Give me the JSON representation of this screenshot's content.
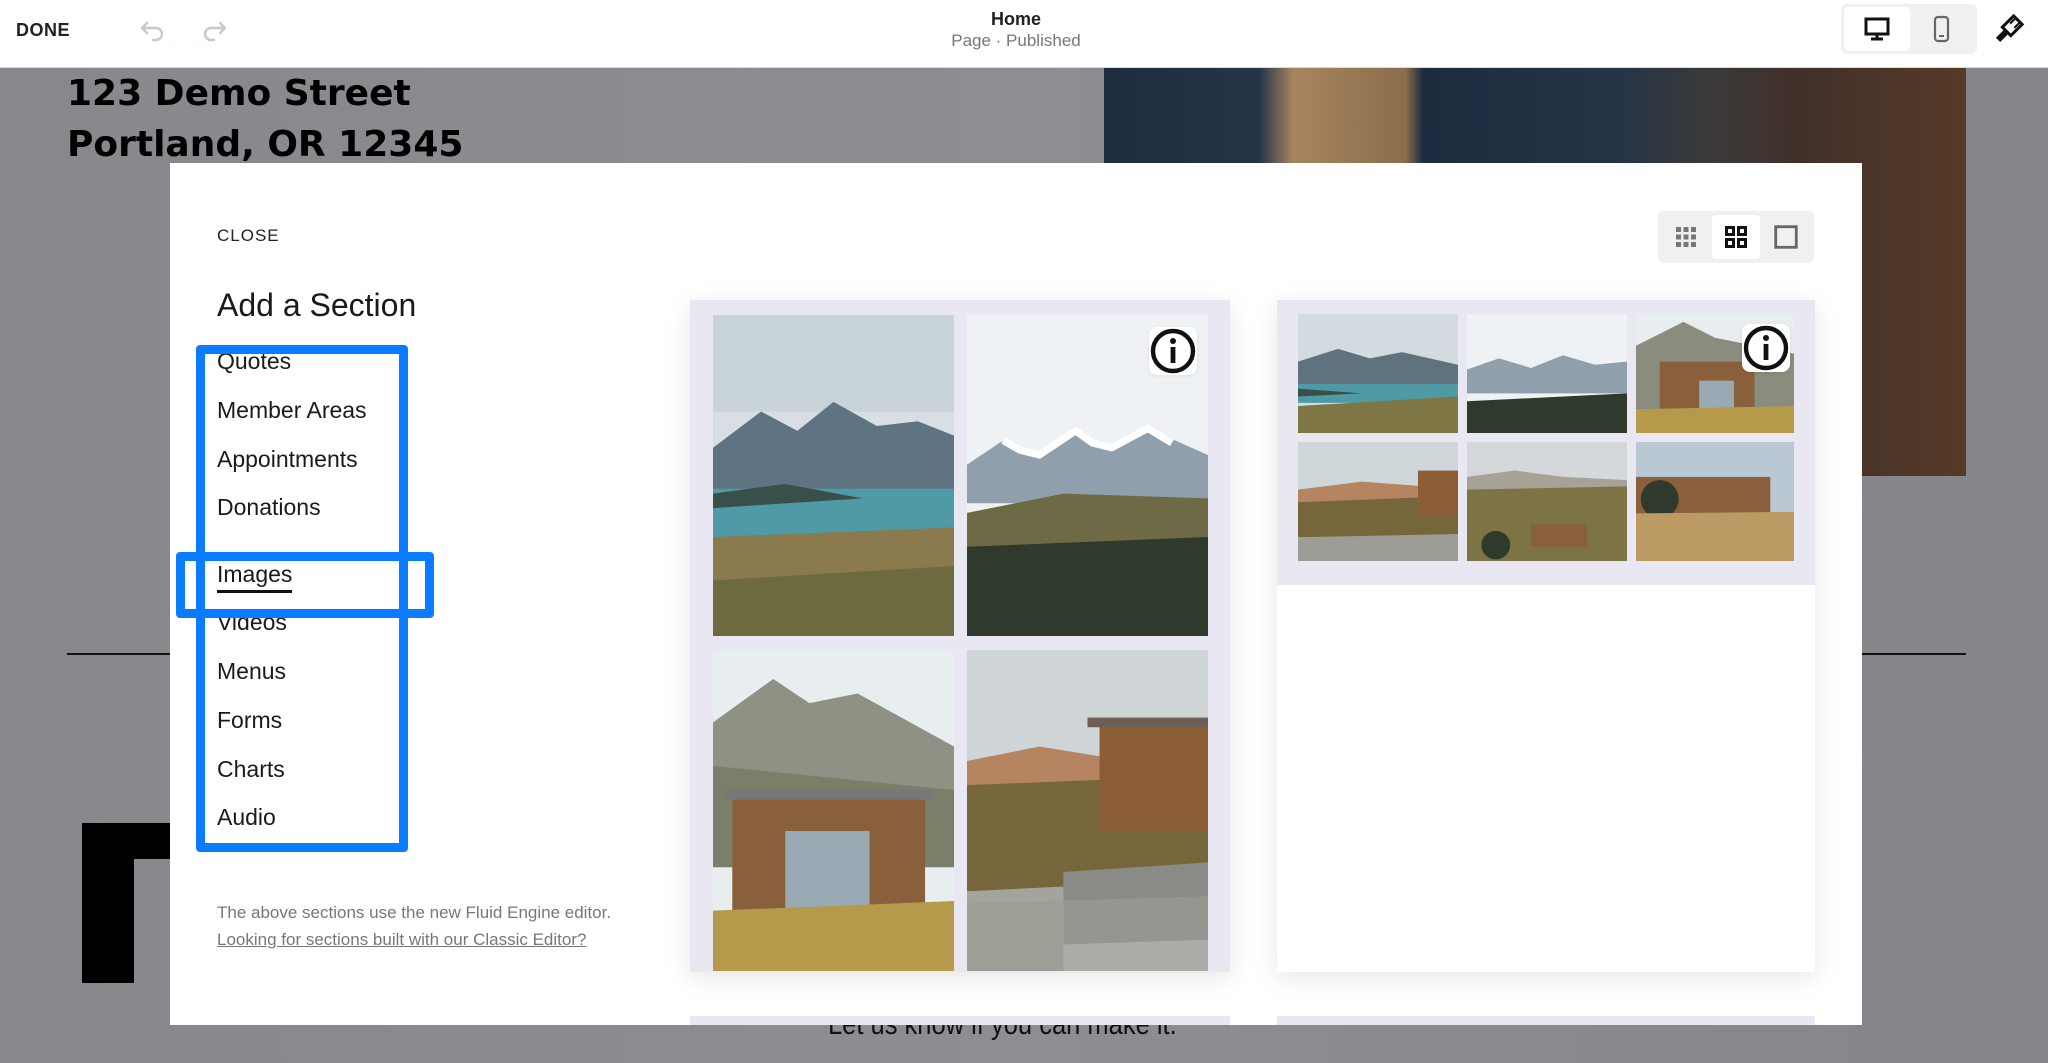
{
  "topbar": {
    "done_label": "DONE",
    "undo_icon": "undo-icon",
    "redo_icon": "redo-icon",
    "page_title": "Home",
    "page_subtitle": "Page · Published",
    "device_toggle": [
      {
        "icon": "desktop-icon",
        "active": true
      },
      {
        "icon": "mobile-icon",
        "active": false
      }
    ],
    "design_icon": "paintbrush-icon"
  },
  "background_page": {
    "address_line1": "123 Demo Street",
    "address_line2": "Portland, OR 12345",
    "tagline": "Let us know if you can make it."
  },
  "modal": {
    "close_label": "CLOSE",
    "title": "Add a Section",
    "categories": [
      {
        "label": "Quotes",
        "selected": false
      },
      {
        "label": "Member Areas",
        "selected": false
      },
      {
        "label": "Appointments",
        "selected": false
      },
      {
        "label": "Donations",
        "selected": false
      },
      {
        "label": "Images",
        "selected": true
      },
      {
        "label": "Videos",
        "selected": false
      },
      {
        "label": "Menus",
        "selected": false
      },
      {
        "label": "Forms",
        "selected": false
      },
      {
        "label": "Charts",
        "selected": false
      },
      {
        "label": "Audio",
        "selected": false
      }
    ],
    "note_text": "The above sections use the new Fluid Engine editor. ",
    "note_link": "Looking for sections built with our Classic Editor?",
    "view_toggle": [
      {
        "icon": "small-grid-icon",
        "active": false
      },
      {
        "icon": "medium-grid-icon",
        "active": true
      },
      {
        "icon": "single-view-icon",
        "active": false
      }
    ],
    "highlight_color": "#0a7cff",
    "templates": [
      {
        "name": "image-layout-2x2",
        "images": [
          "lake-mountains",
          "snowy-peaks",
          "cabin-mountain",
          "cabin-steps"
        ]
      },
      {
        "name": "image-layout-3x2",
        "images": [
          "lake-mountains",
          "snowy-peaks",
          "cabin-mountain",
          "cabin-steps",
          "hillside-cabins",
          "cabin-grassland"
        ]
      }
    ]
  }
}
